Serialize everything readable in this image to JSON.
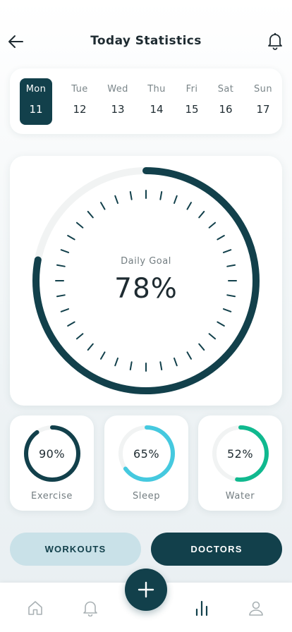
{
  "header": {
    "title": "Today Statistics"
  },
  "calendar": {
    "days": [
      {
        "name": "Mon",
        "num": "11",
        "active": true
      },
      {
        "name": "Tue",
        "num": "12"
      },
      {
        "name": "Wed",
        "num": "13"
      },
      {
        "name": "Thu",
        "num": "14"
      },
      {
        "name": "Fri",
        "num": "15"
      },
      {
        "name": "Sat",
        "num": "16"
      },
      {
        "name": "Sun",
        "num": "17"
      }
    ]
  },
  "goal": {
    "label": "Daily Goal",
    "value": "78%",
    "percent": 78
  },
  "stats": [
    {
      "label": "Exercise",
      "value": "90%",
      "percent": 90,
      "color": "#12404b"
    },
    {
      "label": "Sleep",
      "value": "65%",
      "percent": 65,
      "color": "#45c9df"
    },
    {
      "label": "Water",
      "value": "52%",
      "percent": 52,
      "color": "#10b98f"
    }
  ],
  "buttons": {
    "workouts": "WORKOUTS",
    "doctors": "DOCTORS"
  },
  "colors": {
    "primary": "#12404b",
    "track": "#f1f3f3",
    "accent_light": "#c9e1e8"
  },
  "nav": [
    "home-icon",
    "bell-icon",
    "plus-icon",
    "stats-icon",
    "profile-icon"
  ]
}
